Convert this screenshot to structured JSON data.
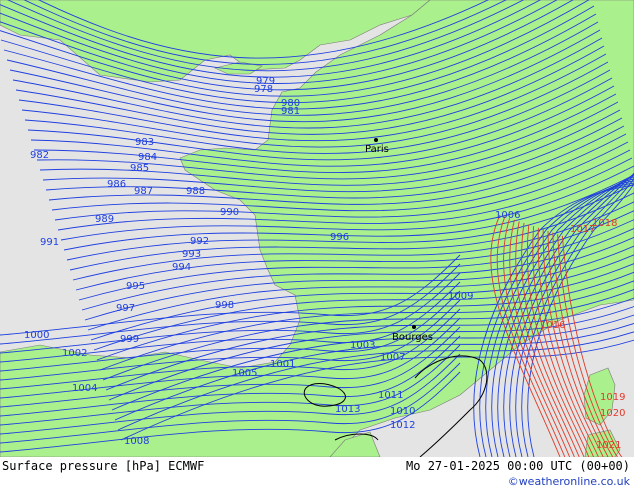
{
  "title": "Surface pressure [hPa] ECMWF",
  "timestamp": "Mo 27-01-2025 00:00 UTC (00+00)",
  "credit": "©weatheronline.co.uk",
  "colors": {
    "sea": "#e4e4e4",
    "land": "#aaf08c",
    "isobar_low": "#1f3fe0",
    "isobar_high": "#e03a2a",
    "border": "#7a7a7a"
  },
  "cities": [
    {
      "name": "Paris"
    },
    {
      "name": "Bourges"
    }
  ],
  "isobar_labels": [
    "978",
    "979",
    "980",
    "981",
    "982",
    "983",
    "984",
    "985",
    "986",
    "987",
    "988",
    "989",
    "990",
    "991",
    "992",
    "993",
    "994",
    "995",
    "996",
    "997",
    "998",
    "999",
    "1000",
    "1001",
    "1002",
    "1003",
    "1004",
    "1005",
    "1006",
    "1007",
    "1008",
    "1009",
    "1010",
    "1011",
    "1012",
    "1013",
    "1016",
    "1017",
    "1018",
    "1019",
    "1020",
    "1021"
  ]
}
